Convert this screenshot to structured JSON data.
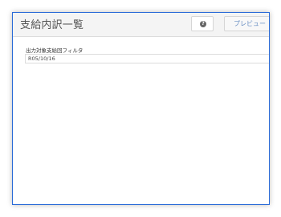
{
  "window": {
    "title": "支給内訳一覧"
  },
  "toolbar": {
    "help_icon": "question-icon",
    "help_glyph": "?",
    "preview_label": "プレビュー"
  },
  "filter": {
    "label": "出力対象支給回フィルタ",
    "value": "R05/10/16"
  },
  "colors": {
    "window_border": "#2a6bd8",
    "preview_text": "#6a8fc3"
  }
}
